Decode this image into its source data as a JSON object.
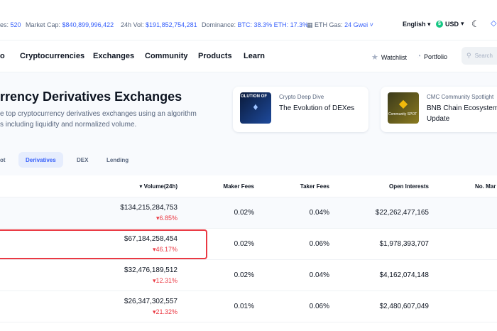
{
  "topbar": {
    "coins_label": "es:",
    "coins_value": "520",
    "market_cap_label": "Market Cap:",
    "market_cap_value": "$840,899,996,422",
    "vol_label": "24h Vol:",
    "vol_value": "$191,852,754,281",
    "dominance_label": "Dominance:",
    "dominance_value": "BTC: 38.3% ETH: 17.3%",
    "gas_label": "ETH Gas:",
    "gas_value": "24 Gwei",
    "language": "English",
    "currency": "USD"
  },
  "nav": {
    "logo_fragment": "o",
    "items": [
      "Cryptocurrencies",
      "Exchanges",
      "Community",
      "Products",
      "Learn"
    ],
    "watchlist": "Watchlist",
    "portfolio": "Portfolio",
    "search_placeholder": "Search"
  },
  "header": {
    "title": "rrency Derivatives Exchanges",
    "description_line1": "e top cryptocurrency derivatives exchanges using an algorithm",
    "description_line2": "s including liquidity and normalized volume."
  },
  "cards": [
    {
      "category": "Crypto Deep Dive",
      "title_line1": "The Evolution of DEXes",
      "title_line2": "",
      "thumb_text": "OLUTION OF"
    },
    {
      "category": "CMC Community Spotlight",
      "title_line1": "BNB Chain Ecosystem",
      "title_line2": "Update",
      "thumb_text": "Community SPOT"
    }
  ],
  "tabs": [
    "ot",
    "Derivatives",
    "DEX",
    "Lending"
  ],
  "active_tab": "Derivatives",
  "table": {
    "headers": {
      "volume": "Volume(24h)",
      "maker": "Maker Fees",
      "taker": "Taker Fees",
      "oi": "Open Interests",
      "markets": "No. Mar"
    },
    "rows": [
      {
        "volume": "$134,215,284,753",
        "change": "6.85%",
        "maker": "0.02%",
        "taker": "0.04%",
        "oi": "$22,262,477,165"
      },
      {
        "volume": "$67,184,258,454",
        "change": "46.17%",
        "maker": "0.02%",
        "taker": "0.06%",
        "oi": "$1,978,393,707"
      },
      {
        "volume": "$32,476,189,512",
        "change": "12.31%",
        "maker": "0.02%",
        "taker": "0.04%",
        "oi": "$4,162,074,148"
      },
      {
        "volume": "$26,347,302,557",
        "change": "21.32%",
        "maker": "0.01%",
        "taker": "0.06%",
        "oi": "$2,480,607,049"
      }
    ]
  },
  "colors": {
    "accent": "#3861fb",
    "negative": "#ea3943",
    "text": "#0d1421",
    "muted": "#58667e"
  }
}
